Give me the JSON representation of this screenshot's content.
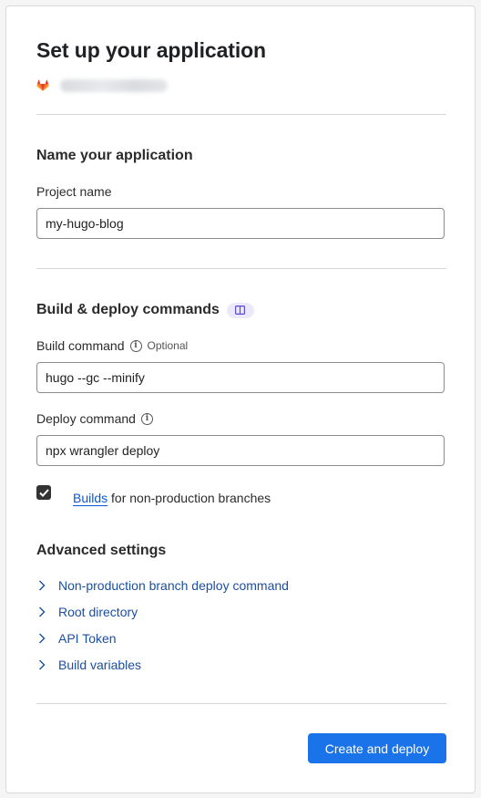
{
  "title": "Set up your application",
  "repo": {
    "icon": "gitlab-icon",
    "name_blurred": ""
  },
  "name_section": {
    "heading": "Name your application",
    "project_label": "Project name",
    "project_value": "my-hugo-blog"
  },
  "build_section": {
    "heading": "Build & deploy commands",
    "doc_icon": "book-icon",
    "build_label": "Build command",
    "build_optional": "Optional",
    "build_value": "hugo --gc --minify",
    "deploy_label": "Deploy command",
    "deploy_value": "npx wrangler deploy",
    "checkbox_checked": true,
    "checkbox_link": "Builds",
    "checkbox_text": " for non-production branches"
  },
  "advanced": {
    "heading": "Advanced settings",
    "items": [
      "Non-production branch deploy command",
      "Root directory",
      "API Token",
      "Build variables"
    ]
  },
  "submit_label": "Create and deploy",
  "colors": {
    "primary": "#1a73e8",
    "link": "#1a4fa3",
    "gitlab": "#e24329"
  }
}
